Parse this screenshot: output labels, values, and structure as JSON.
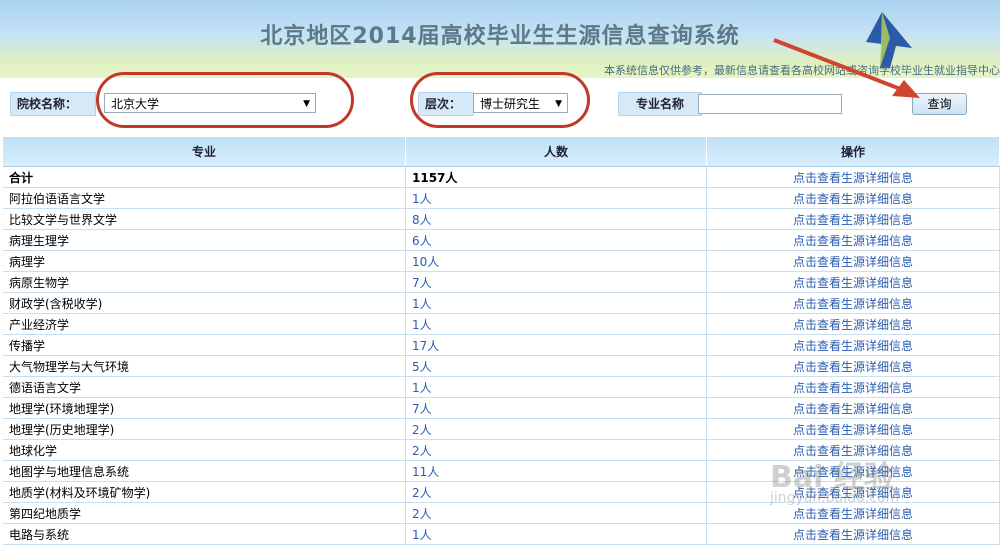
{
  "header": {
    "title": "北京地区2014届高校毕业生生源信息查询系统",
    "notice": "本系统信息仅供参考，最新信息请查看各高校网站或咨询学校毕业生就业指导中心"
  },
  "search": {
    "school_label": "院校名称：",
    "school_value": "北京大学",
    "level_label": "层次：",
    "level_value": "博士研究生",
    "major_label": "专业名称",
    "major_value": "",
    "query_button": "查询"
  },
  "table": {
    "headers": [
      "专业",
      "人数",
      "操作"
    ],
    "rows": [
      {
        "major": "合计",
        "count": "1157人",
        "action": "点击查看生源详细信息"
      },
      {
        "major": "阿拉伯语语言文学",
        "count": "1人",
        "action": "点击查看生源详细信息"
      },
      {
        "major": "比较文学与世界文学",
        "count": "8人",
        "action": "点击查看生源详细信息"
      },
      {
        "major": "病理生理学",
        "count": "6人",
        "action": "点击查看生源详细信息"
      },
      {
        "major": "病理学",
        "count": "10人",
        "action": "点击查看生源详细信息"
      },
      {
        "major": "病原生物学",
        "count": "7人",
        "action": "点击查看生源详细信息"
      },
      {
        "major": "财政学(含税收学)",
        "count": "1人",
        "action": "点击查看生源详细信息"
      },
      {
        "major": "产业经济学",
        "count": "1人",
        "action": "点击查看生源详细信息"
      },
      {
        "major": "传播学",
        "count": "17人",
        "action": "点击查看生源详细信息"
      },
      {
        "major": "大气物理学与大气环境",
        "count": "5人",
        "action": "点击查看生源详细信息"
      },
      {
        "major": "德语语言文学",
        "count": "1人",
        "action": "点击查看生源详细信息"
      },
      {
        "major": "地理学(环境地理学)",
        "count": "7人",
        "action": "点击查看生源详细信息"
      },
      {
        "major": "地理学(历史地理学)",
        "count": "2人",
        "action": "点击查看生源详细信息"
      },
      {
        "major": "地球化学",
        "count": "2人",
        "action": "点击查看生源详细信息"
      },
      {
        "major": "地图学与地理信息系统",
        "count": "11人",
        "action": "点击查看生源详细信息"
      },
      {
        "major": "地质学(材料及环境矿物学)",
        "count": "2人",
        "action": "点击查看生源详细信息"
      },
      {
        "major": "第四纪地质学",
        "count": "2人",
        "action": "点击查看生源详细信息"
      },
      {
        "major": "电路与系统",
        "count": "1人",
        "action": "点击查看生源详细信息"
      }
    ]
  },
  "watermark": {
    "line1": "Bai 经验",
    "line2": "jingyan.baidu.com"
  }
}
